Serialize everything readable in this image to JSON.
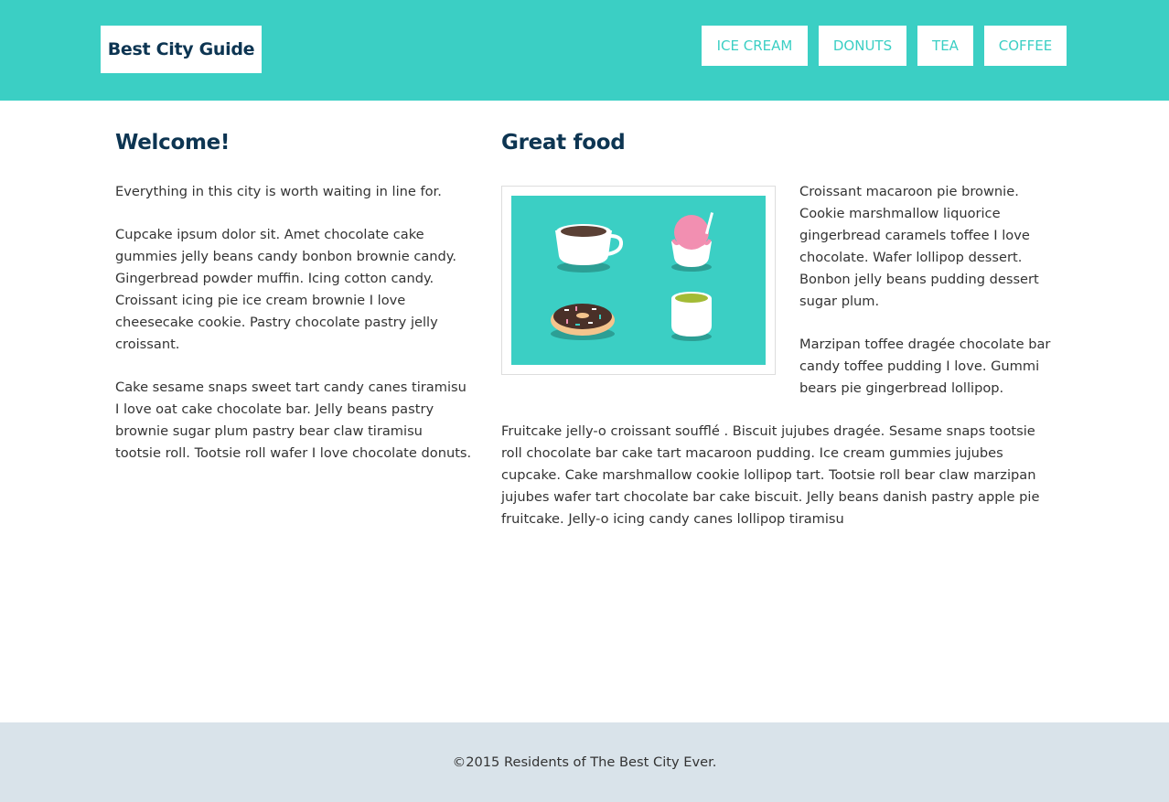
{
  "header": {
    "logo": "Best City Guide",
    "nav": [
      "ICE CREAM",
      "DONUTS",
      "TEA",
      "COFFEE"
    ]
  },
  "welcome": {
    "title": "Welcome!",
    "paragraphs": [
      "Everything in this city is worth waiting in line for.",
      "Cupcake ipsum dolor sit. Amet chocolate cake gummies jelly beans candy bonbon brownie candy. Gingerbread powder muffin. Icing cotton candy. Croissant icing pie ice cream brownie I love cheesecake cookie. Pastry chocolate pastry jelly croissant.",
      "Cake sesame snaps sweet tart candy canes tiramisu I love oat cake chocolate bar. Jelly beans pastry brownie sugar plum pastry bear claw tiramisu tootsie roll. Tootsie roll wafer I love chocolate donuts."
    ]
  },
  "food": {
    "title": "Great food",
    "side_paragraphs": [
      "Croissant macaroon pie brownie. Cookie marshmallow liquorice gingerbread caramels toffee I love chocolate. Wafer lollipop dessert. Bonbon jelly beans pudding dessert sugar plum.",
      "Marzipan toffee dragée chocolate bar candy toffee pudding I love. Gummi bears pie gingerbread lollipop."
    ],
    "full_paragraph": "Fruitcake jelly-o croissant soufflé . Biscuit jujubes dragée. Sesame snaps tootsie roll chocolate bar cake tart macaroon pudding. Ice cream gummies jujubes cupcake. Cake marshmallow cookie lollipop tart. Tootsie roll bear claw marzipan jujubes wafer tart chocolate bar cake biscuit. Jelly beans danish pastry apple pie fruitcake. Jelly-o icing candy canes lollipop tiramisu"
  },
  "footer": {
    "text": "©2015 Residents of The Best City Ever."
  },
  "colors": {
    "accent": "#3bcfc4",
    "heading": "#0d3552",
    "footer_bg": "#d9e3ea"
  },
  "icons": [
    "coffee-cup-icon",
    "ice-cream-icon",
    "donut-icon",
    "tea-cup-icon"
  ]
}
